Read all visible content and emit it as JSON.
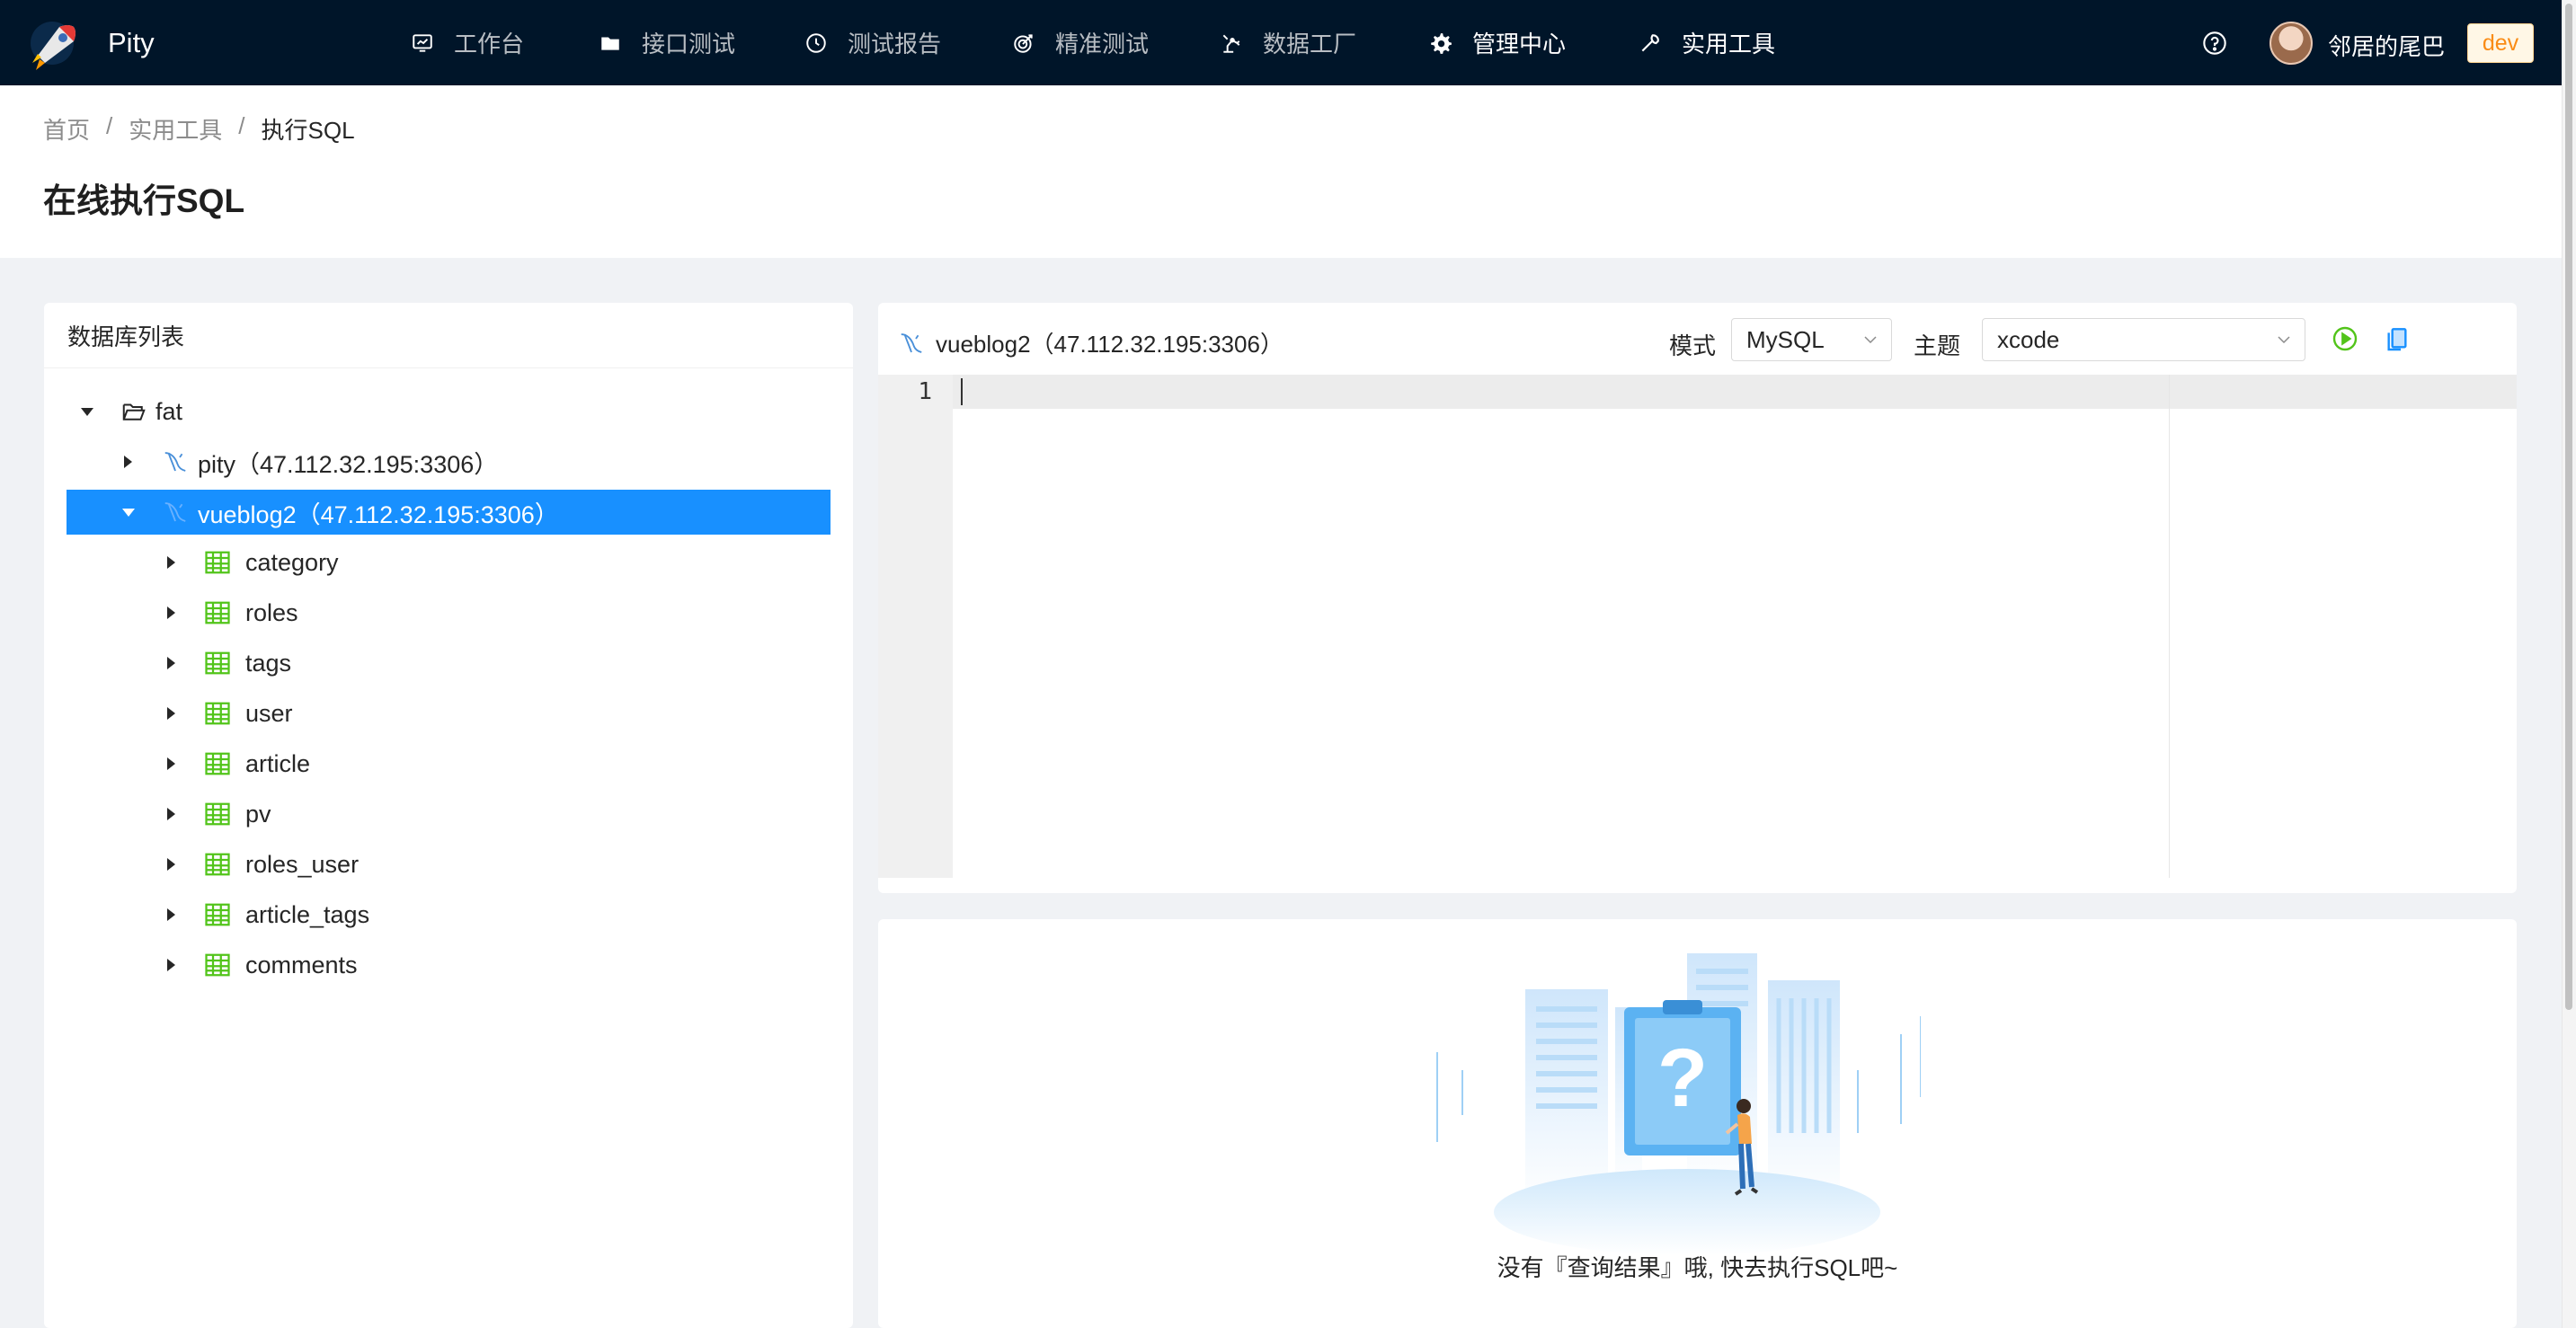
{
  "app": {
    "name": "Pity"
  },
  "nav": {
    "items": [
      {
        "label": "工作台",
        "icon": "dashboard-icon"
      },
      {
        "label": "接口测试",
        "icon": "folder-icon"
      },
      {
        "label": "测试报告",
        "icon": "clock-icon"
      },
      {
        "label": "精准测试",
        "icon": "target-icon"
      },
      {
        "label": "数据工厂",
        "icon": "robot-arm-icon"
      },
      {
        "label": "管理中心",
        "icon": "gear-icon"
      },
      {
        "label": "实用工具",
        "icon": "wrench-icon"
      }
    ],
    "help_icon": "question-circle-icon",
    "user": "邻居的尾巴",
    "env": "dev"
  },
  "breadcrumb": [
    "首页",
    "实用工具",
    "执行SQL"
  ],
  "page_title": "在线执行SQL",
  "db_panel": {
    "title": "数据库列表",
    "tree": {
      "env": "fat",
      "connections": [
        {
          "label": "pity（47.112.32.195:3306）",
          "expanded": false
        },
        {
          "label": "vueblog2（47.112.32.195:3306）",
          "expanded": true,
          "selected": true
        }
      ],
      "tables": [
        "category",
        "roles",
        "tags",
        "user",
        "article",
        "pv",
        "roles_user",
        "article_tags",
        "comments"
      ]
    }
  },
  "editor": {
    "connection": "vueblog2（47.112.32.195:3306）",
    "mode_label": "模式",
    "mode_value": "MySQL",
    "theme_label": "主题",
    "theme_value": "xcode",
    "line_number": "1",
    "run_icon": "play-circle-icon",
    "copy_icon": "copy-icon"
  },
  "result": {
    "empty_text": "没有『查询结果』哦, 快去执行SQL吧~"
  },
  "colors": {
    "nav_bg": "#001529",
    "primary": "#1890ff",
    "table_icon": "#52c41a",
    "run_icon": "#52c41a",
    "env_badge": "#fa8c16"
  }
}
